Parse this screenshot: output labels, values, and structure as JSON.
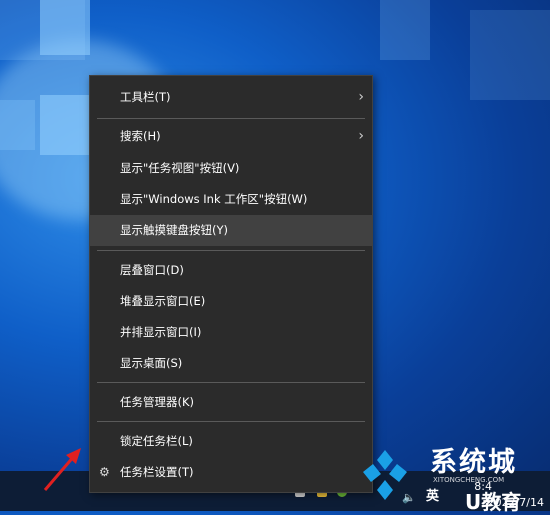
{
  "menu": {
    "items": [
      {
        "label": "工具栏(T)",
        "submenu": true
      },
      {
        "label": "搜索(H)",
        "submenu": true
      },
      {
        "label": "显示\"任务视图\"按钮(V)"
      },
      {
        "label": "显示\"Windows Ink 工作区\"按钮(W)"
      },
      {
        "label": "显示触摸键盘按钮(Y)"
      },
      {
        "label": "层叠窗口(D)"
      },
      {
        "label": "堆叠显示窗口(E)"
      },
      {
        "label": "并排显示窗口(I)"
      },
      {
        "label": "显示桌面(S)"
      },
      {
        "label": "任务管理器(K)"
      },
      {
        "label": "锁定任务栏(L)"
      },
      {
        "label": "任务栏设置(T)",
        "icon": "gear-icon"
      }
    ]
  },
  "taskbar": {
    "lang_label": "英",
    "time": "8:4",
    "date": "2022/7/14"
  },
  "watermark": {
    "chars": "系统城",
    "sub": "U教育",
    "url": "XITONGCHENG.COM"
  },
  "colors": {
    "menu_bg": "#2b2b2b",
    "hover_bg": "#414141",
    "arrow": "#e02020"
  }
}
